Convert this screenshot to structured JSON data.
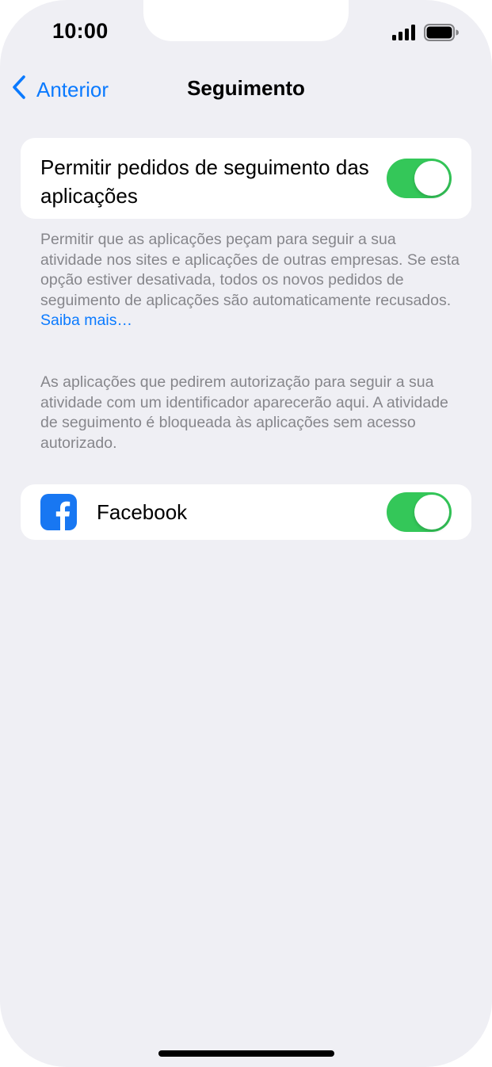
{
  "status_bar": {
    "time": "10:00",
    "signal_icon": "cellular-signal-icon",
    "battery_icon": "battery-icon"
  },
  "nav": {
    "back_label": "Anterior",
    "back_icon": "chevron-left-icon",
    "title": "Seguimento"
  },
  "allow_requests": {
    "label": "Permitir pedidos de seguimento das aplicações",
    "toggle_on": true,
    "footer_text": "Permitir que as aplicações peçam para seguir a sua atividade nos sites e aplicações de outras empresas. Se esta opção estiver desativada, todos os novos pedidos de seguimento de aplicações são automaticamente recusados.",
    "learn_more_link": "Saiba mais…"
  },
  "apps_section": {
    "description": "As aplicações que pedirem autorização para seguir a sua atividade com um identificador aparecerão aqui. A atividade de seguimento é bloqueada às aplicações sem acesso autorizado.",
    "apps": [
      {
        "name": "Facebook",
        "icon": "facebook-icon",
        "toggle_on": true
      }
    ]
  },
  "colors": {
    "accent": "#0a7aff",
    "toggle_on": "#34c759",
    "background": "#efeff4",
    "facebook_blue": "#1877f2",
    "secondary_text": "#86868b"
  }
}
